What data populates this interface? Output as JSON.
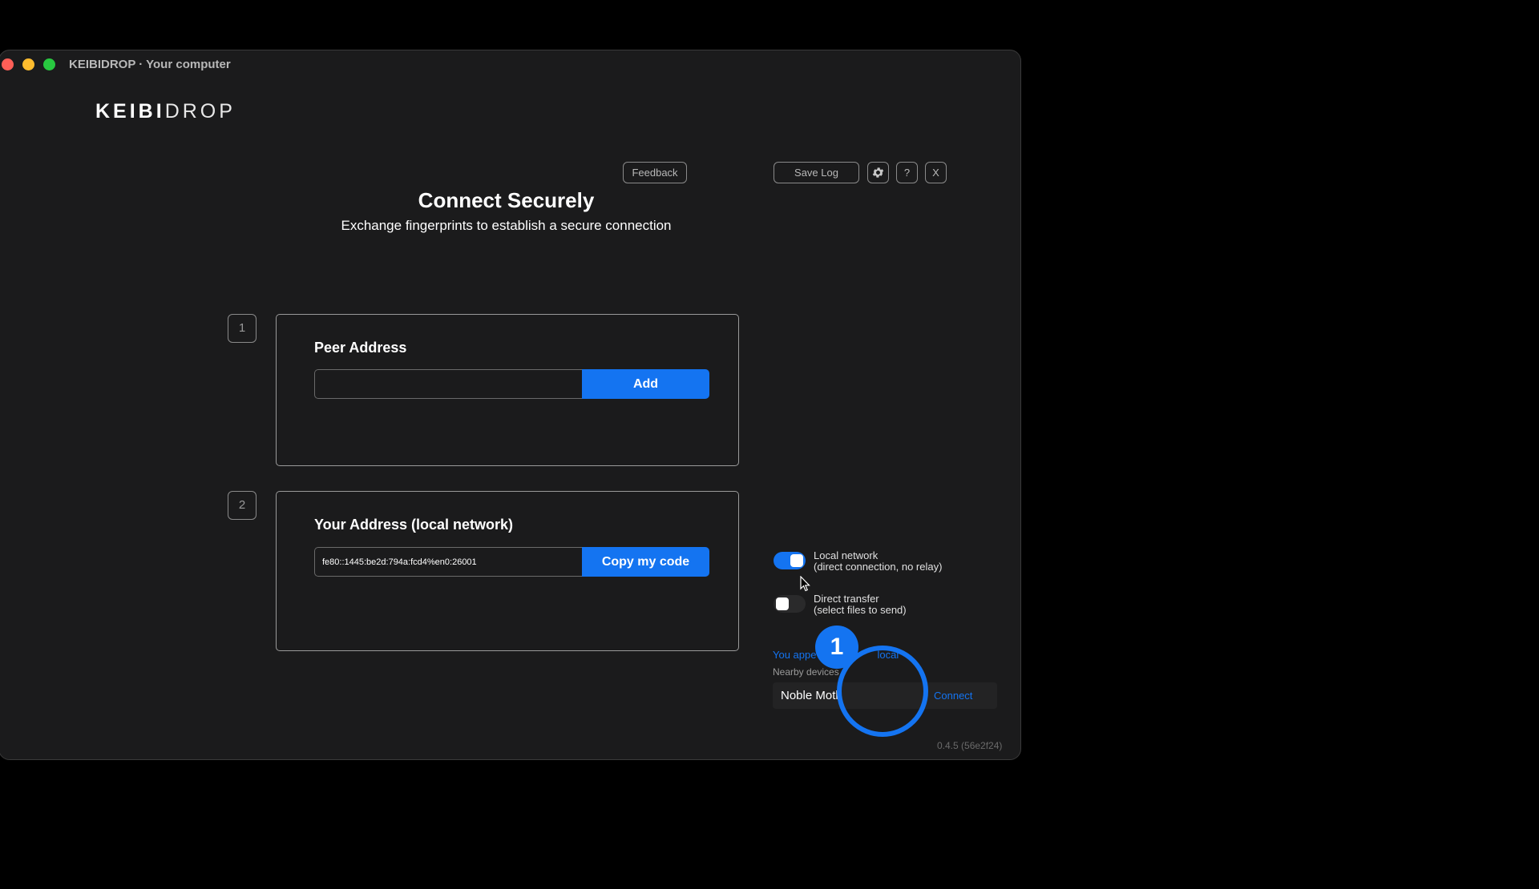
{
  "window": {
    "title": "KEIBIDROP · Your computer"
  },
  "logo": {
    "bold": "KEIBI",
    "light": "DROP"
  },
  "toolbar": {
    "feedback": "Feedback",
    "save_log": "Save Log",
    "settings_icon": "gear-icon",
    "help": "?",
    "close": "X"
  },
  "header": {
    "title": "Connect Securely",
    "subtitle": "Exchange fingerprints to establish a secure connection"
  },
  "steps": [
    {
      "number": "1",
      "title": "Peer Address",
      "input_value": "",
      "button": "Add"
    },
    {
      "number": "2",
      "title": "Your Address (local network)",
      "input_value": "fe80::1445:be2d:794a:fcd4%en0:26001",
      "button": "Copy my code"
    }
  ],
  "options": {
    "local_network": {
      "label": "Local network",
      "detail": "(direct connection, no relay)",
      "enabled": true
    },
    "direct_transfer": {
      "label": "Direct transfer",
      "detail": "(select files to send)",
      "enabled": false
    }
  },
  "nearby": {
    "notice": "You appe",
    "notice_tail": "local",
    "heading": "Nearby devices",
    "devices": [
      {
        "name": "Noble Moth",
        "action": "Connect"
      }
    ]
  },
  "version": "0.4.5 (56e2f24)",
  "overlay": {
    "click_number": "1",
    "accent": "#1474f1"
  }
}
